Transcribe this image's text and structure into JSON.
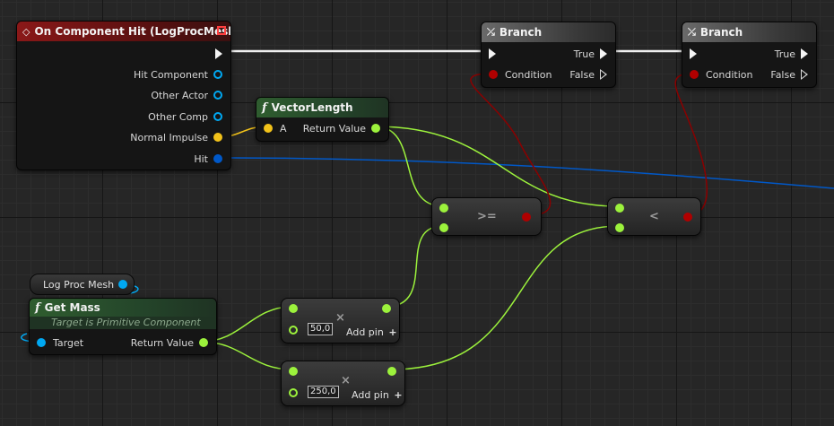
{
  "colors": {
    "exec": "#f4f4f4",
    "float": "#9cf23c",
    "bool": "#8a0000",
    "object": "#00a8f2",
    "struct": "#0058c8",
    "vector": "#f2c21a",
    "event_header": "#8a1818",
    "func_header": "#2f5d2f"
  },
  "event_node": {
    "title": "On Component Hit (LogProcMesh)",
    "icon": "diamond-icon",
    "pins": [
      "Hit Component",
      "Other Actor",
      "Other Comp",
      "Normal Impulse",
      "Hit"
    ]
  },
  "branch1": {
    "title": "Branch",
    "condition": "Condition",
    "true_label": "True",
    "false_label": "False"
  },
  "branch2": {
    "title": "Branch",
    "condition": "Condition",
    "true_label": "True",
    "false_label": "False"
  },
  "vector_length": {
    "title": "VectorLength",
    "input": "A",
    "output": "Return Value"
  },
  "compare_ge": {
    "op": ">="
  },
  "compare_lt": {
    "op": "<"
  },
  "var_node": {
    "label": "Log Proc Mesh"
  },
  "get_mass": {
    "title": "Get Mass",
    "subtitle": "Target is Primitive Component",
    "input": "Target",
    "output": "Return Value"
  },
  "multiply1": {
    "value": "50,0",
    "add_pin": "Add pin",
    "op_icon": "multiply-icon"
  },
  "multiply2": {
    "value": "250,0",
    "add_pin": "Add pin",
    "op_icon": "multiply-icon"
  }
}
